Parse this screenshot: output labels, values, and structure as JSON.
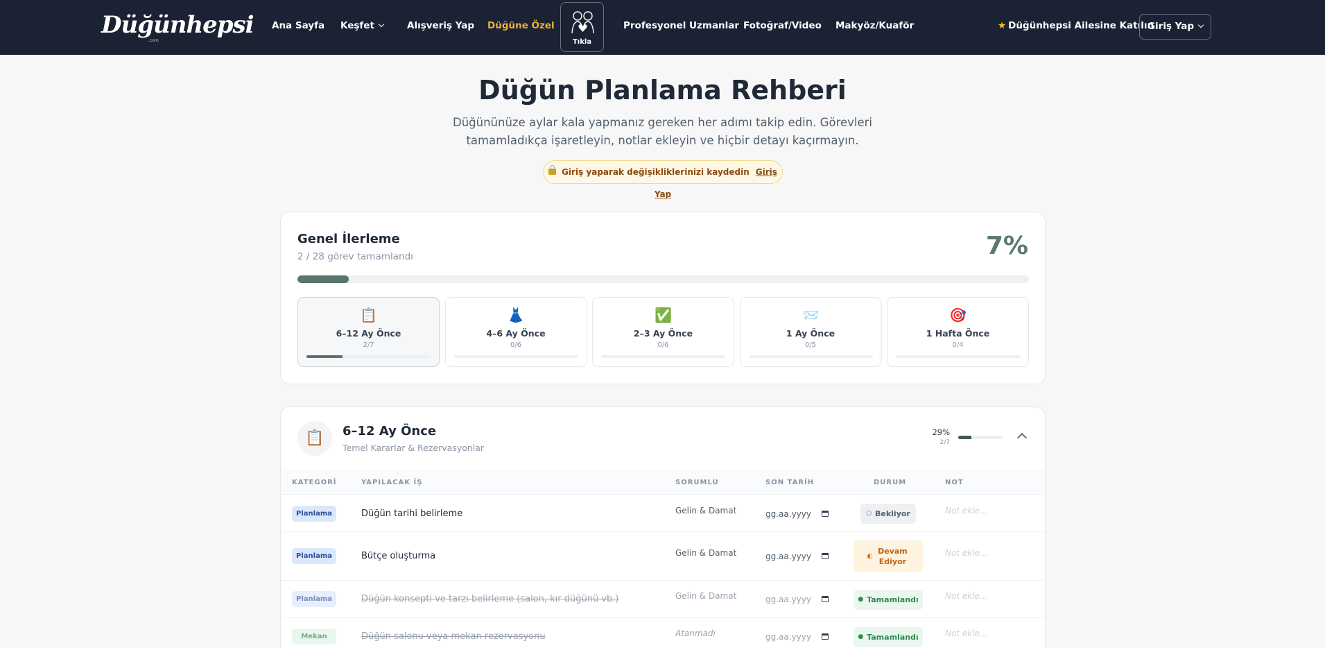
{
  "nav": {
    "logo": "Düğünhepsi",
    "logo_sub": ".com",
    "links": [
      "Ana Sayfa",
      "Keşfet",
      "Alışveriş Yap",
      "Düğüne Özel",
      "Profesyonel Uzmanlar",
      "Fotoğraf/Video",
      "Makyöz/Kuaför"
    ],
    "tikla": "Tıkla",
    "join": "Düğünhepsi Ailesine Katılın",
    "login": "Giriş Yap",
    "active_color": "#e9b23c"
  },
  "header": {
    "title": "Düğün Planlama Rehberi",
    "subtitle": "Düğününüze aylar kala yapmanız gereken her adımı takip edin. Görevleri tamamladıkça işaretleyin, notlar ekleyin ve hiçbir detayı kaçırmayın.",
    "save_note": "Giriş yaparak değişikliklerinizi kaydedin",
    "save_link": "Giriş Yap"
  },
  "progress": {
    "title": "Genel İlerleme",
    "summary": "2 / 28 görev tamamlandı",
    "percent_label": "7%",
    "percent": 7,
    "phases": [
      {
        "icon": "📋",
        "name": "6–12 Ay Önce",
        "count": "2/7",
        "fraction": 0.29
      },
      {
        "icon": "👗",
        "name": "4–6 Ay Önce",
        "count": "0/6",
        "fraction": 0
      },
      {
        "icon": "✅",
        "name": "2–3 Ay Önce",
        "count": "0/6",
        "fraction": 0
      },
      {
        "icon": "📨",
        "name": "1 Ay Önce",
        "count": "0/5",
        "fraction": 0
      },
      {
        "icon": "🎯",
        "name": "1 Hafta Önce",
        "count": "0/4",
        "fraction": 0
      }
    ]
  },
  "section": {
    "icon": "📋",
    "title": "6–12 Ay Önce",
    "subtitle": "Temel Kararlar & Rezervasyonlar",
    "percent_label": "29%",
    "count": "2/7",
    "fraction": 0.29,
    "columns": [
      "KATEGORİ",
      "YAPILACAK İŞ",
      "SORUMLU",
      "SON TARİH",
      "DURUM",
      "NOT"
    ],
    "rows": [
      {
        "category": "Planlama",
        "task": "Düğün tarihi belirleme",
        "responsible": "Gelin & Damat",
        "date": "gg.aa.yyyy",
        "status": "Bekliyor",
        "status_icon": "○",
        "note": "Not ekle..."
      },
      {
        "category": "Planlama",
        "task": "Bütçe oluşturma",
        "responsible": "Gelin & Damat",
        "date": "gg.aa.yyyy",
        "status": "Devam Ediyor",
        "status_icon": "◐",
        "note": "Not ekle..."
      },
      {
        "category": "Planlama",
        "task": "Düğün konsepti ve tarzı belirleme (salon, kır düğünü vb.)",
        "responsible": "Gelin & Damat",
        "date": "gg.aa.yyyy",
        "status": "Tamamlandı",
        "status_icon": "●",
        "note": "Not ekle..."
      },
      {
        "category": "Mekan",
        "task": "Düğün salonu veya mekan rezervasyonu",
        "responsible": "Atanmadı",
        "date": "gg.aa.yyyy",
        "status": "Tamamlandı",
        "status_icon": "●",
        "note": "Not ekle..."
      }
    ]
  },
  "colors": {
    "nav_bg": "#1a2233",
    "progress_fill": "#58776a",
    "planlama_badge": "#dbe7fb",
    "mekan_badge": "#dcf3e6"
  }
}
